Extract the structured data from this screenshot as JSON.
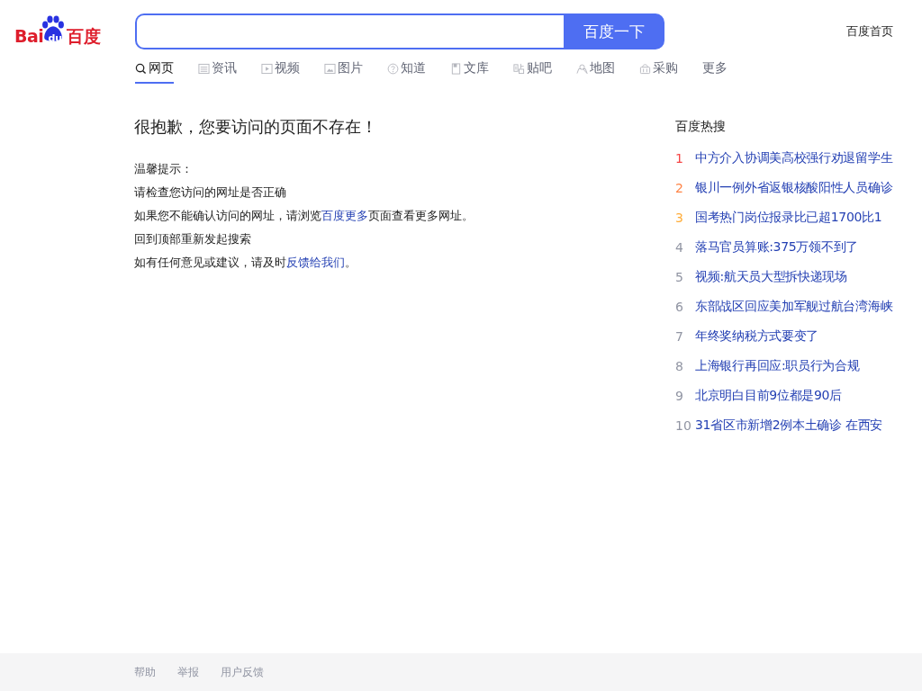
{
  "logo": {
    "left": "Bai",
    "paw_text": "du",
    "right": "百度"
  },
  "search": {
    "button": "百度一下"
  },
  "top_link": "百度首页",
  "tabs": [
    {
      "label": "网页",
      "kind": "search",
      "selected": true
    },
    {
      "label": "资讯",
      "kind": "news",
      "selected": false
    },
    {
      "label": "视频",
      "kind": "video",
      "selected": false
    },
    {
      "label": "图片",
      "kind": "image",
      "selected": false
    },
    {
      "label": "知道",
      "kind": "question",
      "selected": false
    },
    {
      "label": "文库",
      "kind": "doc",
      "selected": false
    },
    {
      "label": "贴吧",
      "kind": "tieba",
      "selected": false
    },
    {
      "label": "地图",
      "kind": "map",
      "selected": false
    },
    {
      "label": "采购",
      "kind": "shop",
      "selected": false
    },
    {
      "label": "更多",
      "kind": "more",
      "selected": false
    }
  ],
  "error": {
    "title": "很抱歉，您要访问的页面不存在！",
    "lines": [
      [
        {
          "text": "温馨提示："
        }
      ],
      [
        {
          "text": "请检查您访问的网址是否正确"
        }
      ],
      [
        {
          "text": "如果您不能确认访问的网址，请浏览"
        },
        {
          "text": "百度更多",
          "link": true
        },
        {
          "text": "页面查看更多网址。"
        }
      ],
      [
        {
          "text": "回到顶部重新发起搜索"
        }
      ],
      [
        {
          "text": "如有任何意见或建议，请及时"
        },
        {
          "text": "反馈给我们",
          "link": true
        },
        {
          "text": "。"
        }
      ]
    ]
  },
  "hot": {
    "title": "百度热搜",
    "items": [
      {
        "rank": "1",
        "color": "#f54545",
        "text": "中方介入协调美高校强行劝退留学生"
      },
      {
        "rank": "2",
        "color": "#ff8547",
        "text": "银川一例外省返银核酸阳性人员确诊"
      },
      {
        "rank": "3",
        "color": "#ffac38",
        "text": "国考热门岗位报录比已超1700比1"
      },
      {
        "rank": "4",
        "color": "#9195a3",
        "text": "落马官员算账:375万领不到了"
      },
      {
        "rank": "5",
        "color": "#9195a3",
        "text": "视频:航天员大型拆快递现场"
      },
      {
        "rank": "6",
        "color": "#9195a3",
        "text": "东部战区回应美加军舰过航台湾海峡"
      },
      {
        "rank": "7",
        "color": "#9195a3",
        "text": "年终奖纳税方式要变了"
      },
      {
        "rank": "8",
        "color": "#9195a3",
        "text": "上海银行再回应:职员行为合规"
      },
      {
        "rank": "9",
        "color": "#9195a3",
        "text": "北京明白目前9位都是90后"
      },
      {
        "rank": "10",
        "color": "#9195a3",
        "text": "31省区市新增2例本土确诊 在西安"
      }
    ]
  },
  "footer": [
    "帮助",
    "举报",
    "用户反馈"
  ]
}
